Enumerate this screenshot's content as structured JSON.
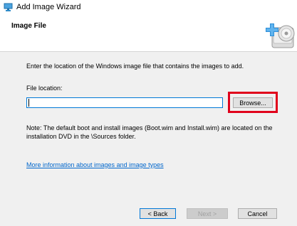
{
  "window": {
    "title": "Add Image Wizard",
    "icon": "wizard-app-icon"
  },
  "header": {
    "title": "Image File",
    "icon": "add-image-disc-icon"
  },
  "content": {
    "instruction": "Enter the location of the Windows image file that contains the images to add.",
    "file_location_label": "File location:",
    "file_location_value": "",
    "browse_label": "Browse...",
    "note_line1": "Note: The default boot and install images (Boot.wim and Install.wim) are located on the",
    "note_line2": "installation DVD in the \\Sources folder.",
    "more_info_link": "More information about images and image types"
  },
  "footer": {
    "back_label": "< Back",
    "next_label": "Next >",
    "cancel_label": "Cancel"
  },
  "colors": {
    "highlight": "#e0001b",
    "link": "#0066cc",
    "focus_border": "#0078d7"
  }
}
